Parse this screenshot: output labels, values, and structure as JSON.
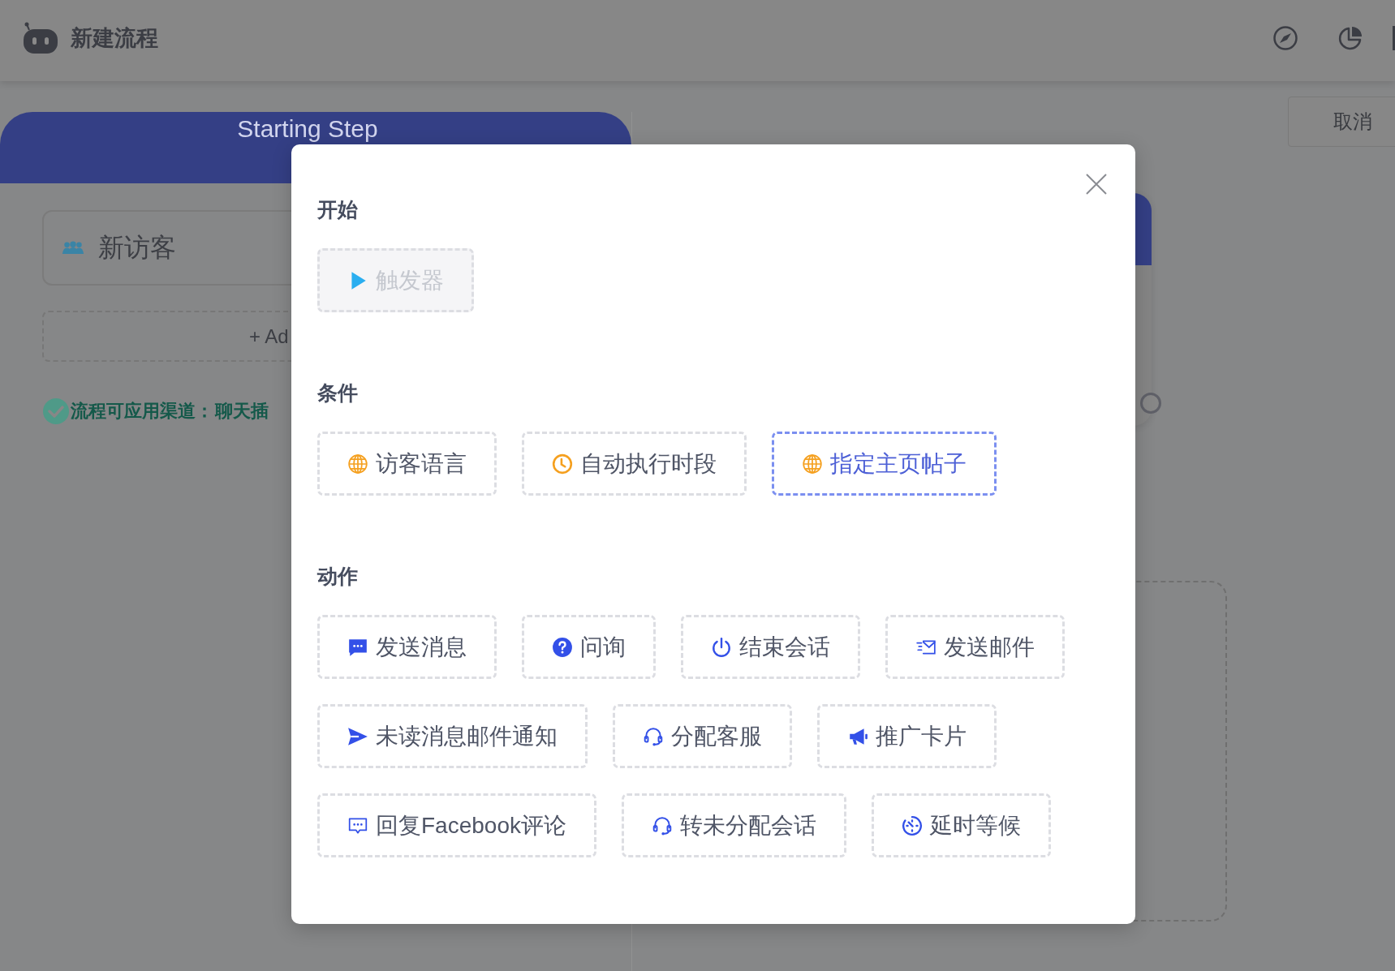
{
  "header": {
    "title": "新建流程"
  },
  "cancel_button": "取消",
  "start_panel": {
    "title": "Starting Step",
    "trigger_label": "新访客",
    "add_label": "+ Ad",
    "channels_label": "流程可应用渠道：",
    "channels_value": "聊天插"
  },
  "modal": {
    "sections": [
      {
        "title": "开始",
        "items": [
          {
            "label": "触发器",
            "selected": false,
            "disabled": true
          }
        ]
      },
      {
        "title": "条件",
        "items": [
          {
            "label": "访客语言",
            "selected": false,
            "disabled": false
          },
          {
            "label": "自动执行时段",
            "selected": false,
            "disabled": false
          },
          {
            "label": "指定主页帖子",
            "selected": true,
            "disabled": false
          }
        ]
      },
      {
        "title": "动作",
        "items": [
          {
            "label": "发送消息",
            "selected": false,
            "disabled": false
          },
          {
            "label": "问询",
            "selected": false,
            "disabled": false
          },
          {
            "label": "结束会话",
            "selected": false,
            "disabled": false
          },
          {
            "label": "发送邮件",
            "selected": false,
            "disabled": false
          },
          {
            "label": "未读消息邮件通知",
            "selected": false,
            "disabled": false
          },
          {
            "label": "分配客服",
            "selected": false,
            "disabled": false
          },
          {
            "label": "推广卡片",
            "selected": false,
            "disabled": false
          },
          {
            "label": "回复Facebook评论",
            "selected": false,
            "disabled": false
          },
          {
            "label": "转未分配会话",
            "selected": false,
            "disabled": false
          },
          {
            "label": "延时等候",
            "selected": false,
            "disabled": false
          }
        ]
      }
    ]
  }
}
